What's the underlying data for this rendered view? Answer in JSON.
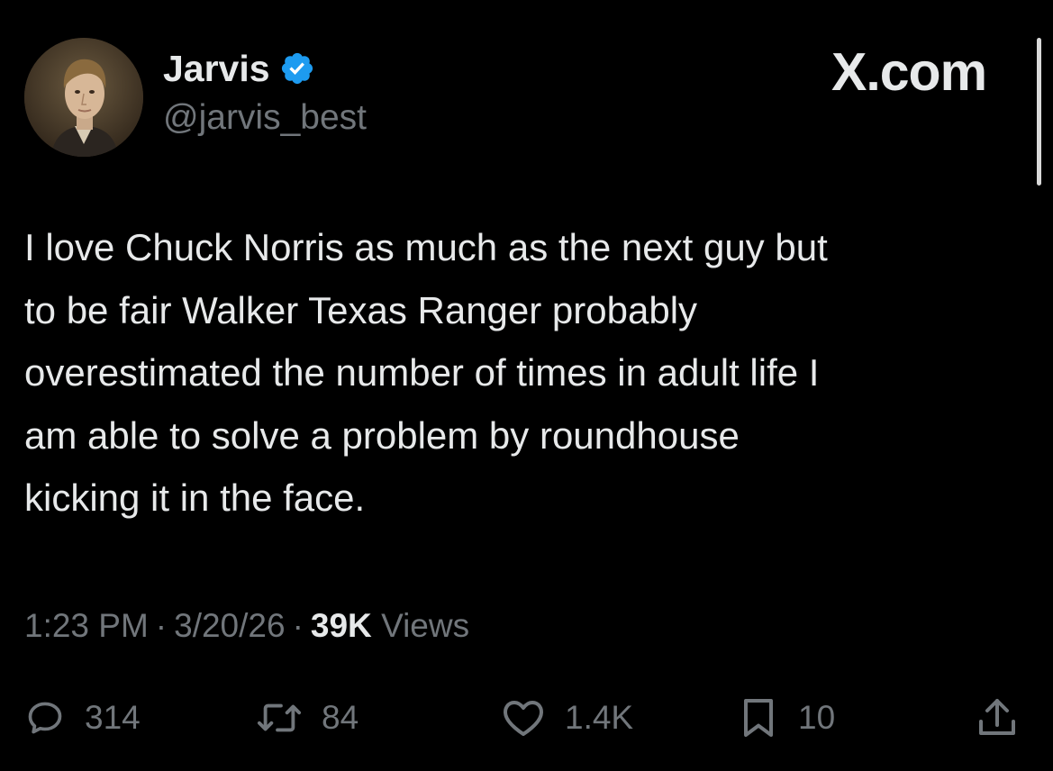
{
  "author": {
    "display_name": "Jarvis",
    "handle": "@jarvis_best",
    "verified_icon": "verified-badge-icon",
    "avatar": "portrait-avatar"
  },
  "brand": {
    "label": "X.com"
  },
  "tweet": {
    "lines": [
      "I love Chuck Norris as much as the next guy but",
      "to be fair Walker Texas Ranger probably",
      "overestimated the number of times in adult life I",
      "am able to solve a problem by roundhouse",
      "kicking it in the face."
    ]
  },
  "meta": {
    "time": "1:23 PM",
    "separator": "·",
    "date": "3/20/26",
    "views_count": "39K",
    "views_label": "Views"
  },
  "actions": {
    "reply": {
      "icon": "reply-icon",
      "count": "314"
    },
    "retweet": {
      "icon": "retweet-icon",
      "count": "84"
    },
    "like": {
      "icon": "heart-icon",
      "count": "1.4K"
    },
    "bookmark": {
      "icon": "bookmark-icon",
      "count": "10"
    },
    "share": {
      "icon": "share-icon"
    }
  },
  "colors": {
    "background": "#000000",
    "primary_text": "#e7e9ea",
    "secondary_text": "#71767b",
    "verified": "#1d9bf0"
  }
}
